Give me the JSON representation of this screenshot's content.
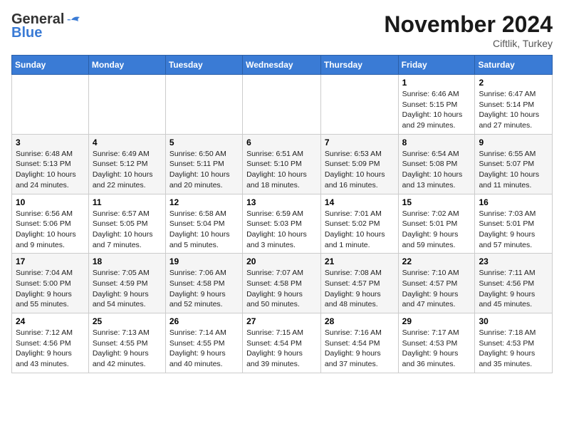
{
  "header": {
    "logo_general": "General",
    "logo_blue": "Blue",
    "month_title": "November 2024",
    "location": "Ciftlik, Turkey"
  },
  "weekdays": [
    "Sunday",
    "Monday",
    "Tuesday",
    "Wednesday",
    "Thursday",
    "Friday",
    "Saturday"
  ],
  "rows": [
    {
      "cells": [
        {
          "day": "",
          "info": ""
        },
        {
          "day": "",
          "info": ""
        },
        {
          "day": "",
          "info": ""
        },
        {
          "day": "",
          "info": ""
        },
        {
          "day": "",
          "info": ""
        },
        {
          "day": "1",
          "info": "Sunrise: 6:46 AM\nSunset: 5:15 PM\nDaylight: 10 hours\nand 29 minutes."
        },
        {
          "day": "2",
          "info": "Sunrise: 6:47 AM\nSunset: 5:14 PM\nDaylight: 10 hours\nand 27 minutes."
        }
      ]
    },
    {
      "cells": [
        {
          "day": "3",
          "info": "Sunrise: 6:48 AM\nSunset: 5:13 PM\nDaylight: 10 hours\nand 24 minutes."
        },
        {
          "day": "4",
          "info": "Sunrise: 6:49 AM\nSunset: 5:12 PM\nDaylight: 10 hours\nand 22 minutes."
        },
        {
          "day": "5",
          "info": "Sunrise: 6:50 AM\nSunset: 5:11 PM\nDaylight: 10 hours\nand 20 minutes."
        },
        {
          "day": "6",
          "info": "Sunrise: 6:51 AM\nSunset: 5:10 PM\nDaylight: 10 hours\nand 18 minutes."
        },
        {
          "day": "7",
          "info": "Sunrise: 6:53 AM\nSunset: 5:09 PM\nDaylight: 10 hours\nand 16 minutes."
        },
        {
          "day": "8",
          "info": "Sunrise: 6:54 AM\nSunset: 5:08 PM\nDaylight: 10 hours\nand 13 minutes."
        },
        {
          "day": "9",
          "info": "Sunrise: 6:55 AM\nSunset: 5:07 PM\nDaylight: 10 hours\nand 11 minutes."
        }
      ]
    },
    {
      "cells": [
        {
          "day": "10",
          "info": "Sunrise: 6:56 AM\nSunset: 5:06 PM\nDaylight: 10 hours\nand 9 minutes."
        },
        {
          "day": "11",
          "info": "Sunrise: 6:57 AM\nSunset: 5:05 PM\nDaylight: 10 hours\nand 7 minutes."
        },
        {
          "day": "12",
          "info": "Sunrise: 6:58 AM\nSunset: 5:04 PM\nDaylight: 10 hours\nand 5 minutes."
        },
        {
          "day": "13",
          "info": "Sunrise: 6:59 AM\nSunset: 5:03 PM\nDaylight: 10 hours\nand 3 minutes."
        },
        {
          "day": "14",
          "info": "Sunrise: 7:01 AM\nSunset: 5:02 PM\nDaylight: 10 hours\nand 1 minute."
        },
        {
          "day": "15",
          "info": "Sunrise: 7:02 AM\nSunset: 5:01 PM\nDaylight: 9 hours\nand 59 minutes."
        },
        {
          "day": "16",
          "info": "Sunrise: 7:03 AM\nSunset: 5:01 PM\nDaylight: 9 hours\nand 57 minutes."
        }
      ]
    },
    {
      "cells": [
        {
          "day": "17",
          "info": "Sunrise: 7:04 AM\nSunset: 5:00 PM\nDaylight: 9 hours\nand 55 minutes."
        },
        {
          "day": "18",
          "info": "Sunrise: 7:05 AM\nSunset: 4:59 PM\nDaylight: 9 hours\nand 54 minutes."
        },
        {
          "day": "19",
          "info": "Sunrise: 7:06 AM\nSunset: 4:58 PM\nDaylight: 9 hours\nand 52 minutes."
        },
        {
          "day": "20",
          "info": "Sunrise: 7:07 AM\nSunset: 4:58 PM\nDaylight: 9 hours\nand 50 minutes."
        },
        {
          "day": "21",
          "info": "Sunrise: 7:08 AM\nSunset: 4:57 PM\nDaylight: 9 hours\nand 48 minutes."
        },
        {
          "day": "22",
          "info": "Sunrise: 7:10 AM\nSunset: 4:57 PM\nDaylight: 9 hours\nand 47 minutes."
        },
        {
          "day": "23",
          "info": "Sunrise: 7:11 AM\nSunset: 4:56 PM\nDaylight: 9 hours\nand 45 minutes."
        }
      ]
    },
    {
      "cells": [
        {
          "day": "24",
          "info": "Sunrise: 7:12 AM\nSunset: 4:56 PM\nDaylight: 9 hours\nand 43 minutes."
        },
        {
          "day": "25",
          "info": "Sunrise: 7:13 AM\nSunset: 4:55 PM\nDaylight: 9 hours\nand 42 minutes."
        },
        {
          "day": "26",
          "info": "Sunrise: 7:14 AM\nSunset: 4:55 PM\nDaylight: 9 hours\nand 40 minutes."
        },
        {
          "day": "27",
          "info": "Sunrise: 7:15 AM\nSunset: 4:54 PM\nDaylight: 9 hours\nand 39 minutes."
        },
        {
          "day": "28",
          "info": "Sunrise: 7:16 AM\nSunset: 4:54 PM\nDaylight: 9 hours\nand 37 minutes."
        },
        {
          "day": "29",
          "info": "Sunrise: 7:17 AM\nSunset: 4:53 PM\nDaylight: 9 hours\nand 36 minutes."
        },
        {
          "day": "30",
          "info": "Sunrise: 7:18 AM\nSunset: 4:53 PM\nDaylight: 9 hours\nand 35 minutes."
        }
      ]
    }
  ]
}
